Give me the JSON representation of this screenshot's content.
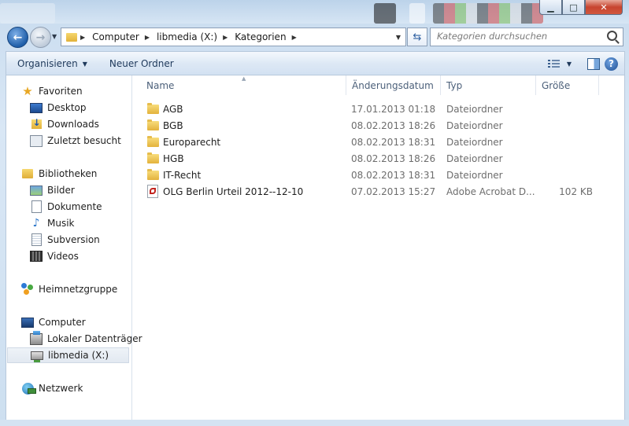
{
  "window": {
    "minimize_glyph": "▁",
    "maximize_glyph": "□",
    "close_glyph": "✕",
    "accent_color": "#1f5ea8"
  },
  "navigation": {
    "back_glyph": "←",
    "forward_glyph": "→",
    "history_glyph": "▼",
    "breadcrumb": [
      "Computer",
      "libmedia (X:)",
      "Kategorien"
    ],
    "refresh_glyph": "⇆",
    "search_placeholder": "Kategorien durchsuchen"
  },
  "toolbar": {
    "organize_label": "Organisieren",
    "organize_drop": "▼",
    "new_folder_label": "Neuer Ordner",
    "views_drop": "▼",
    "help_label": "?"
  },
  "sidebar": {
    "favorites": {
      "label": "Favoriten",
      "icon": "star-icon"
    },
    "favorites_items": [
      {
        "label": "Desktop",
        "icon": "desktop-icon"
      },
      {
        "label": "Downloads",
        "icon": "downloads-icon"
      },
      {
        "label": "Zuletzt besucht",
        "icon": "recent-places-icon"
      }
    ],
    "libraries": {
      "label": "Bibliotheken",
      "icon": "libraries-icon"
    },
    "libraries_items": [
      {
        "label": "Bilder",
        "icon": "pictures-icon"
      },
      {
        "label": "Dokumente",
        "icon": "documents-icon"
      },
      {
        "label": "Musik",
        "icon": "music-icon"
      },
      {
        "label": "Subversion",
        "icon": "subversion-icon"
      },
      {
        "label": "Videos",
        "icon": "videos-icon"
      }
    ],
    "homegroup": {
      "label": "Heimnetzgruppe",
      "icon": "homegroup-icon"
    },
    "computer": {
      "label": "Computer",
      "icon": "computer-icon"
    },
    "computer_items": [
      {
        "label": "Lokaler Datenträger",
        "icon": "local-disk-icon"
      },
      {
        "label": "libmedia (X:)",
        "icon": "network-drive-icon",
        "selected": true
      }
    ],
    "network": {
      "label": "Netzwerk",
      "icon": "network-icon"
    }
  },
  "file_list": {
    "sort_glyph": "▲",
    "columns": [
      "Name",
      "Änderungsdatum",
      "Typ",
      "Größe"
    ],
    "rows": [
      {
        "name": "AGB",
        "date": "17.01.2013 01:18",
        "type": "Dateiordner",
        "size": "",
        "icon": "folder-icon"
      },
      {
        "name": "BGB",
        "date": "08.02.2013 18:26",
        "type": "Dateiordner",
        "size": "",
        "icon": "folder-icon"
      },
      {
        "name": "Europarecht",
        "date": "08.02.2013 18:31",
        "type": "Dateiordner",
        "size": "",
        "icon": "folder-icon"
      },
      {
        "name": "HGB",
        "date": "08.02.2013 18:26",
        "type": "Dateiordner",
        "size": "",
        "icon": "folder-icon"
      },
      {
        "name": "IT-Recht",
        "date": "08.02.2013 18:31",
        "type": "Dateiordner",
        "size": "",
        "icon": "folder-icon"
      },
      {
        "name": "OLG Berlin Urteil 2012--12-10",
        "date": "07.02.2013 15:27",
        "type": "Adobe Acrobat D...",
        "size": "102 KB",
        "icon": "pdf-icon"
      }
    ]
  }
}
